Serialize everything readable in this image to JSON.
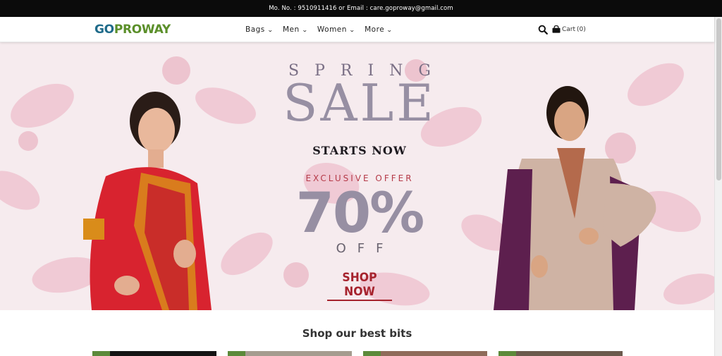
{
  "topbar": {
    "contact": "Mo. No. : 9510911416 or Email : care.goproway@gmail.com"
  },
  "brand": {
    "part1": "GO",
    "part2": "PROWAY",
    "color_go": "#1f6b8a",
    "color_proway": "#5b8f2a"
  },
  "nav": {
    "items": [
      {
        "label": "Bags"
      },
      {
        "label": "Men"
      },
      {
        "label": "Women"
      },
      {
        "label": "More"
      }
    ],
    "search_icon": "search-icon",
    "cart_icon": "shopping-bag-icon",
    "cart_label": "Cart",
    "cart_count": "(0)"
  },
  "hero": {
    "line1": "SPRING",
    "line2": "SALE",
    "line3": "STARTS NOW",
    "line4": "EXCLUSIVE OFFER",
    "line5": "70%",
    "line6": "OFF",
    "cta": "SHOP NOW",
    "accent": "#a6232d"
  },
  "section": {
    "title": "Shop our best bits"
  }
}
